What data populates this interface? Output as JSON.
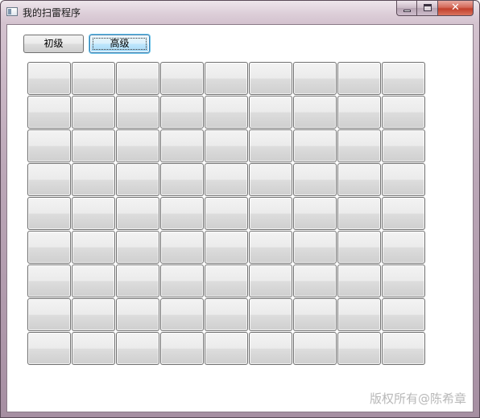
{
  "window": {
    "title": "我的扫雷程序",
    "close_glyph": "✕"
  },
  "toolbar": {
    "easy_label": "初级",
    "hard_label": "高级"
  },
  "board": {
    "columns": 9,
    "rows": 9
  },
  "watermark": "版权所有@陈希章",
  "icons": {
    "app": "window-app-icon",
    "minimize": "minimize-icon",
    "maximize": "maximize-icon",
    "close": "close-icon"
  },
  "colors": {
    "title_bar": "#bca8b8",
    "close_button": "#c2402c",
    "focused_button_border": "#3c7fb1",
    "watermark": "#b8b8b8"
  }
}
